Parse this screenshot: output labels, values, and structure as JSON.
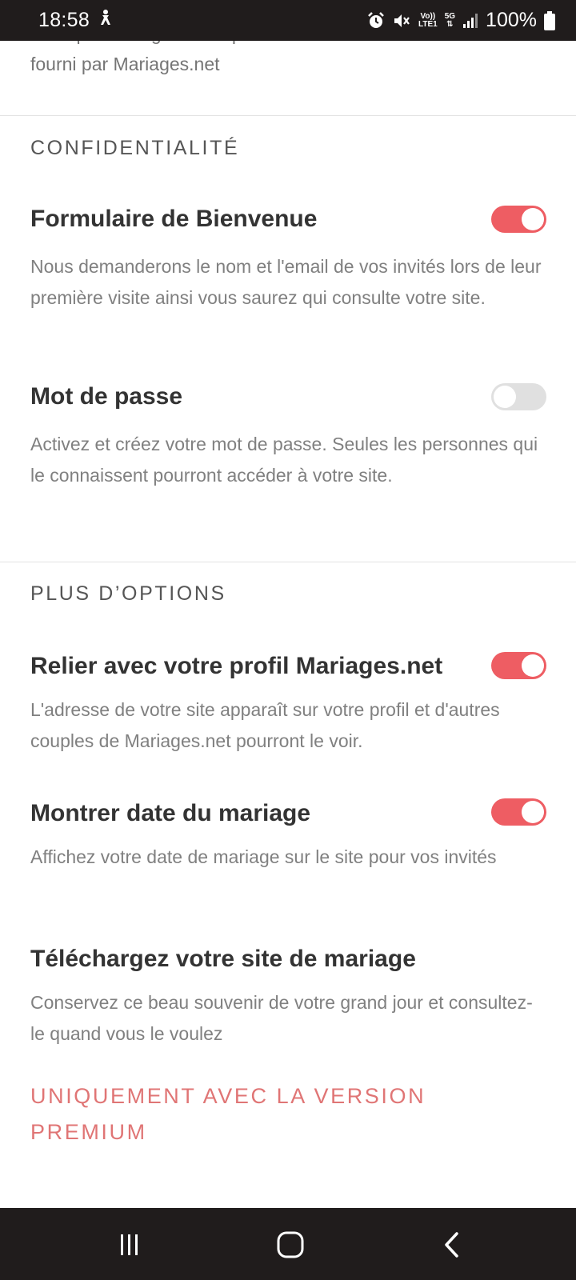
{
  "status_bar": {
    "time": "18:58",
    "network_top": "Vo))",
    "network_bottom": "LTE1",
    "network_5g": "5G",
    "battery": "100%"
  },
  "clipped_text": "Vous pouvez également personnaliser le nom de domaine fourni par Mariages.net",
  "sections": {
    "privacy": {
      "title": "CONFIDENTIALITÉ",
      "welcome_form": {
        "title": "Formulaire de Bienvenue",
        "description": "Nous demanderons le nom et l'email de vos invités lors de leur première visite ainsi vous saurez qui consulte votre site.",
        "enabled": true
      },
      "password": {
        "title": "Mot de passe",
        "description": "Activez et créez votre mot de passe. Seules les personnes qui le connaissent pourront accéder à votre site.",
        "enabled": false
      }
    },
    "more_options": {
      "title": "PLUS D’OPTIONS",
      "link_profile": {
        "title": "Relier avec votre profil Mariages.net",
        "description": "L'adresse de votre site apparaît sur votre profil et d'autres couples de Mariages.net pourront le voir.",
        "enabled": true
      },
      "show_date": {
        "title": "Montrer date du mariage",
        "description": "Affichez votre date de mariage sur le site pour vos invités",
        "enabled": true
      },
      "download": {
        "title": "Téléchargez votre site de mariage",
        "description": "Conservez ce beau souvenir de votre grand jour et consultez-le quand vous le voulez",
        "premium_label": "UNIQUEMENT AVEC LA VERSION PREMIUM"
      }
    }
  },
  "colors": {
    "accent": "#ee5d63",
    "premium": "#e07575",
    "toggle_off": "#e0e0e0",
    "system_bar": "#201c1c"
  },
  "icons": {
    "status_left": "accessibility-icon",
    "status_right": [
      "alarm-icon",
      "mute-icon",
      "signal-icon",
      "battery-icon"
    ],
    "nav": [
      "recents-icon",
      "home-icon",
      "back-icon"
    ]
  }
}
